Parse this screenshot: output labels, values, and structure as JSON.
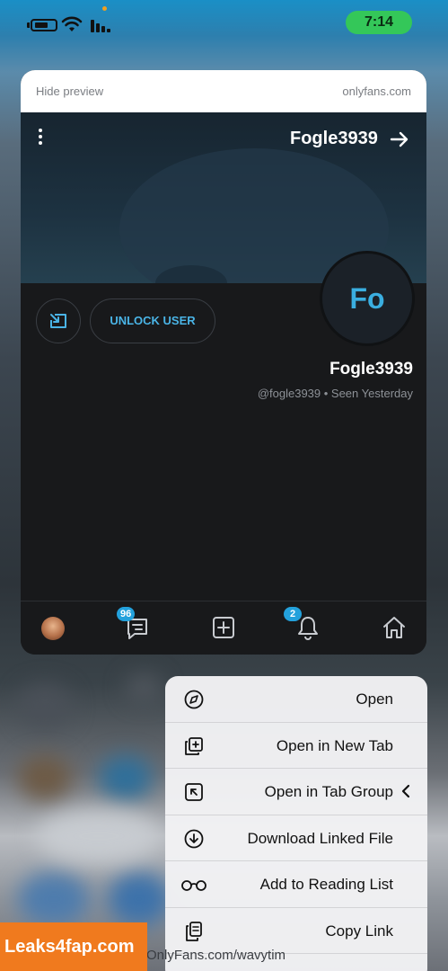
{
  "status_bar": {
    "time": "7:14"
  },
  "preview": {
    "hide_label": "Hide preview",
    "domain": "onlyfans.com",
    "header_title": "Fogle3939",
    "avatar_initials": "Fo",
    "unlock_button": "UNLOCK USER",
    "display_name": "Fogle3939",
    "handle_line": "@fogle3939  •  Seen  Yesterday",
    "tabs": {
      "messages_badge": "96",
      "notifications_badge": "2"
    }
  },
  "context_menu": {
    "items": [
      {
        "label": "Open",
        "icon": "compass-icon"
      },
      {
        "label": "Open in New Tab",
        "icon": "new-tab-icon"
      },
      {
        "label": "Open in Tab Group",
        "icon": "tab-group-icon"
      },
      {
        "label": "Download Linked File",
        "icon": "download-icon"
      },
      {
        "label": "Add to Reading List",
        "icon": "glasses-icon"
      },
      {
        "label": "Copy Link",
        "icon": "copy-icon"
      }
    ]
  },
  "url_peek": "OnlyFans.com/wavytim",
  "watermark": "Leaks4fap.com",
  "colors": {
    "accent": "#23a1dc",
    "clock_pill": "#34c759",
    "watermark": "#f07a1e"
  }
}
